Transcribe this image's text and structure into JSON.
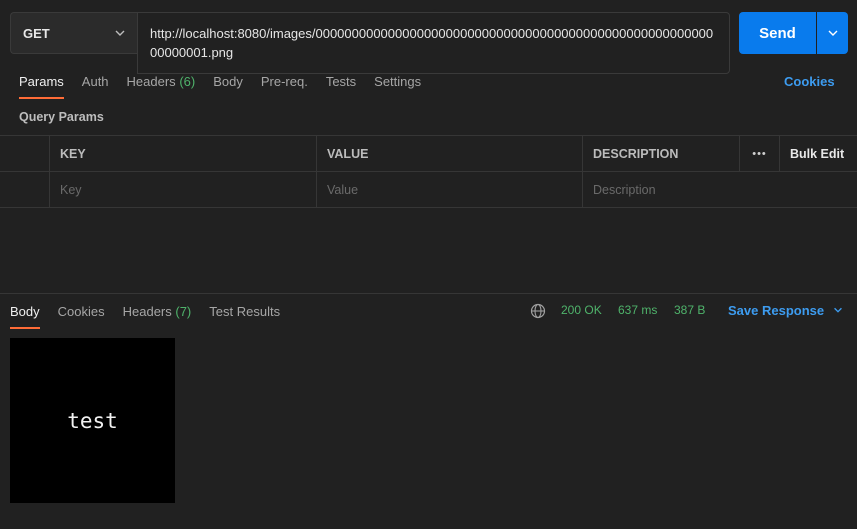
{
  "request": {
    "method": "GET",
    "url": "http://localhost:8080/images/000000000000000000000000000000000000000000000000000000000000001.png",
    "send_label": "Send"
  },
  "request_tabs": [
    {
      "label": "Params",
      "active": true
    },
    {
      "label": "Auth"
    },
    {
      "label": "Headers",
      "count": "(6)"
    },
    {
      "label": "Body"
    },
    {
      "label": "Pre-req."
    },
    {
      "label": "Tests"
    },
    {
      "label": "Settings"
    }
  ],
  "cookies_label": "Cookies",
  "query_params": {
    "title": "Query Params",
    "headers": {
      "key": "KEY",
      "value": "VALUE",
      "description": "DESCRIPTION",
      "more": "•••",
      "bulk_edit": "Bulk Edit"
    },
    "placeholders": {
      "key": "Key",
      "value": "Value",
      "description": "Description"
    }
  },
  "response_tabs": [
    {
      "label": "Body",
      "active": true
    },
    {
      "label": "Cookies"
    },
    {
      "label": "Headers",
      "count": "(7)"
    },
    {
      "label": "Test Results"
    }
  ],
  "response": {
    "status": "200 OK",
    "time": "637 ms",
    "size": "387 B",
    "save_label": "Save Response",
    "preview_text": "test"
  },
  "colors": {
    "accent": "#097bed",
    "active_tab": "#ff6c37",
    "success": "#4fb36b",
    "link": "#3d9cf0"
  }
}
